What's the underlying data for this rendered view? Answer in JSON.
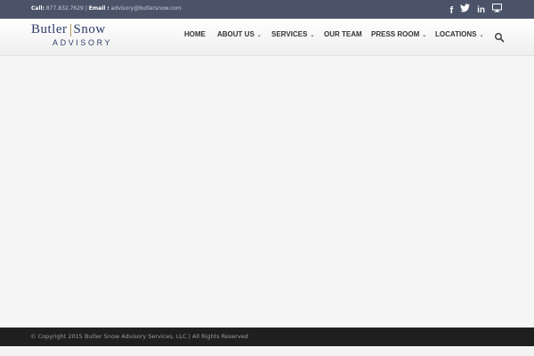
{
  "topbar": {
    "call_label": "Call:",
    "phone": "877.832.7629",
    "separator": "|",
    "email_label": "Email :",
    "email": "advisory@butlersnow.com",
    "social_icons": [
      "facebook-icon",
      "twitter-icon",
      "linkedin-icon",
      "monitor-icon"
    ],
    "background_color": "#4b5368"
  },
  "logo": {
    "word1": "Butler",
    "word2": "Snow",
    "subtitle": "ADVISORY",
    "brand_color": "#2f3d6b",
    "separator_color": "#b39a56"
  },
  "nav": {
    "items": [
      {
        "label": "HOME",
        "dropdown": false
      },
      {
        "label": "ABOUT US",
        "dropdown": true
      },
      {
        "label": "SERVICES",
        "dropdown": true
      },
      {
        "label": "OUR TEAM",
        "dropdown": false
      },
      {
        "label": "PRESS ROOM",
        "dropdown": true
      },
      {
        "label": "LOCATIONS",
        "dropdown": true
      }
    ],
    "dropdown_glyph": "⌄",
    "search_icon": "search-icon"
  },
  "footer": {
    "copyright": "© Copyright 2015 Butler Snow Advisory Services, LLC | All Rights Reserved",
    "background_color": "#1f1f1f"
  }
}
